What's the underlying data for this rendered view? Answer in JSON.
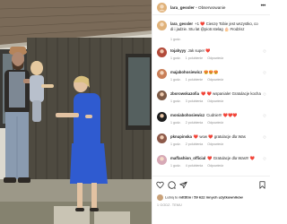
{
  "post": {
    "author": "lara_gessler",
    "separator": "•",
    "follow_label": "Obserwowanie",
    "more_label": "•••"
  },
  "comments": [
    {
      "user": "lara_gessler",
      "text": "+1 ❤️ Cieszę Tobie jest wszystko, co di i jadzie. Stu lat @piotr.stelag 🎂 #rodzisz",
      "meta": [
        "1 godz."
      ],
      "like": false
    },
    {
      "user": "tojahyyy",
      "text": "Jak super ❤️",
      "meta": [
        "1 godz.",
        "1 polubienie",
        "Odpowiedz"
      ],
      "like": true
    },
    {
      "user": "majabohosiewicz",
      "text": "😍😍😍",
      "meta": [
        "1 godz.",
        "1 polubienie",
        "Odpowiedz"
      ],
      "like": true
    },
    {
      "user": "zborowskazofia",
      "text": "❤️ ❤️ wspaniale! Gratulacje kocha",
      "meta": [
        "1 godz.",
        "3 polubienia",
        "Odpowiedz"
      ],
      "like": true
    },
    {
      "user": "moniabohosiewicz",
      "text": "Cudnie!!! ❤️❤️❤️",
      "meta": [
        "1 godz.",
        "2 polubienia",
        "Odpowiedz"
      ],
      "like": true
    },
    {
      "user": "pknupinska",
      "text": "❤️ wow ❤️ gratulacje dla Was",
      "meta": [
        "1 godz.",
        "2 polubienia",
        "Odpowiedz"
      ],
      "like": true
    },
    {
      "user": "maffashion_official",
      "text": "❤️ Gratulacje dla Was!!! ❤️",
      "meta": [
        "1 godz.",
        "4 polubienia",
        "Odpowiedz"
      ],
      "like": true
    }
  ],
  "actions": {
    "likes_prefix": "Lubią to",
    "likes_user": "mtttttm",
    "likes_mid": "i",
    "likes_count": "59 622 innych użytkowników",
    "date": "1 GODZ. TEMU"
  },
  "colors": {
    "like_red": "#ed4956",
    "text": "#262626",
    "muted": "#8e8e8e",
    "border": "#efefef"
  },
  "icons": [
    "more-icon",
    "heart-icon",
    "comment-icon",
    "share-icon",
    "bookmark-icon",
    "like-small-icon"
  ]
}
